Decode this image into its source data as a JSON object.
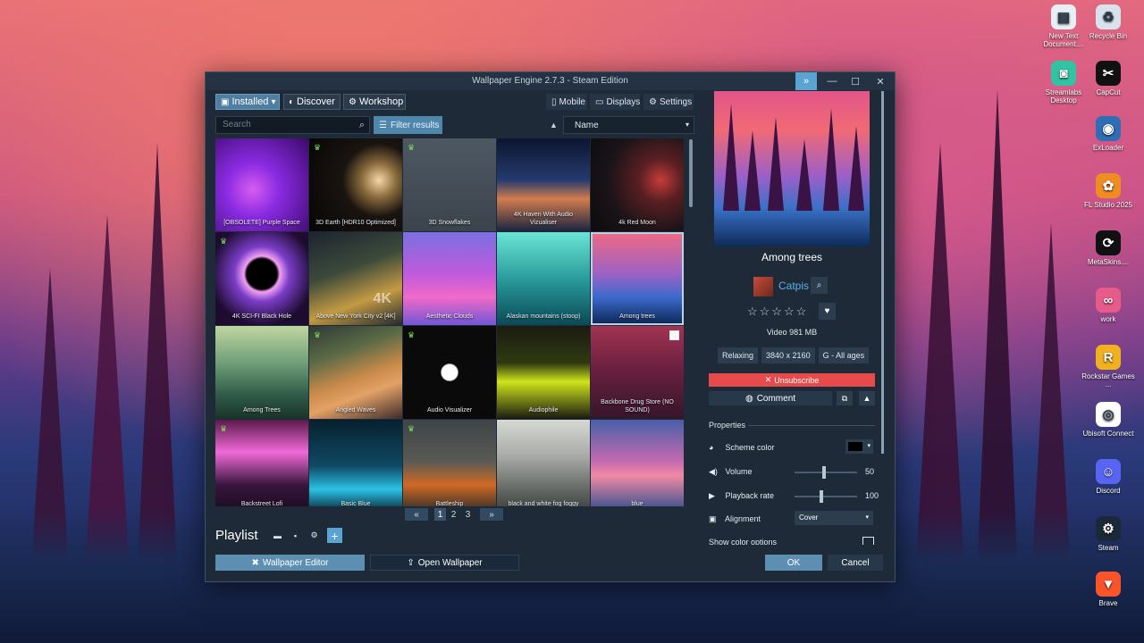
{
  "window": {
    "title": "Wallpaper Engine 2.7.3 - Steam Edition",
    "nav": {
      "installed": "Installed",
      "discover": "Discover",
      "workshop": "Workshop"
    },
    "right_nav": {
      "mobile": "Mobile",
      "displays": "Displays",
      "settings": "Settings"
    },
    "search_placeholder": "Search",
    "filter_label": "Filter results",
    "sort_value": "Name"
  },
  "wallpapers": [
    {
      "label": "[OBSOLETE] Purple Space",
      "trophy": false
    },
    {
      "label": "3D Earth [HDR10 Optimized]",
      "trophy": true
    },
    {
      "label": "3D Snowflakes",
      "trophy": true
    },
    {
      "label": "4K Haven With Audio Vizualiser",
      "trophy": false
    },
    {
      "label": "4k Red Moon",
      "trophy": false
    },
    {
      "label": "4K SCI-FI Black Hole",
      "trophy": true
    },
    {
      "label": "Above New York City v2 [4K]",
      "trophy": false,
      "overlay": "4K"
    },
    {
      "label": "Aesthetic Clouds",
      "trophy": false
    },
    {
      "label": "Alaskan mountains (stoop)",
      "trophy": false
    },
    {
      "label": "Among trees",
      "trophy": false
    },
    {
      "label": "Among Trees",
      "trophy": false
    },
    {
      "label": "Angled Waves",
      "trophy": true
    },
    {
      "label": "Audio Visualizer",
      "trophy": true
    },
    {
      "label": "Audiophile",
      "trophy": false
    },
    {
      "label": "Backbone Drug Store (NO SOUND)",
      "trophy": false
    },
    {
      "label": "Backstreet Lofi",
      "trophy": true
    },
    {
      "label": "Basic Blue",
      "trophy": false
    },
    {
      "label": "Battleship",
      "trophy": true
    },
    {
      "label": "black and white fog foggy",
      "trophy": false
    },
    {
      "label": "blue",
      "trophy": false
    }
  ],
  "pagination": {
    "pages": [
      "1",
      "2",
      "3"
    ],
    "current": "1"
  },
  "playlist": {
    "title": "Playlist"
  },
  "footer": {
    "editor": "Wallpaper Editor",
    "open": "Open Wallpaper",
    "ok": "OK",
    "cancel": "Cancel"
  },
  "details": {
    "title": "Among trees",
    "author": "Catpis",
    "rating_stars": "☆☆☆☆☆",
    "meta": "Video 981 MB",
    "tags": [
      "Relaxing",
      "3840 x 2160",
      "G - All ages"
    ],
    "unsubscribe": "Unsubscribe",
    "comment": "Comment"
  },
  "properties": {
    "title": "Properties",
    "scheme_color": {
      "label": "Scheme color",
      "value": "#000000"
    },
    "volume": {
      "label": "Volume",
      "value": "50"
    },
    "playback_rate": {
      "label": "Playback rate",
      "value": "100"
    },
    "alignment": {
      "label": "Alignment",
      "value": "Cover"
    },
    "show_color_options": {
      "label": "Show color options"
    }
  },
  "desktop_icons": [
    {
      "label": "New Text Document....",
      "name": "text-document-icon",
      "glyph": "▤",
      "color": "#e8eef4"
    },
    {
      "label": "Recycle Bin",
      "name": "recycle-bin-icon",
      "glyph": "♻",
      "color": "#d8e2ec"
    },
    {
      "label": "Streamlabs Desktop",
      "name": "streamlabs-icon",
      "glyph": "◙",
      "color": "#31c3a2"
    },
    {
      "label": "CapCut",
      "name": "capcut-icon",
      "glyph": "✂",
      "color": "#111111"
    },
    {
      "label": "ExLoader",
      "name": "exloader-icon",
      "glyph": "◉",
      "color": "#2f6db5"
    },
    {
      "label": "FL Studio 2025",
      "name": "fl-studio-icon",
      "glyph": "✿",
      "color": "#f08c24"
    },
    {
      "label": "MetaSkins....",
      "name": "metaskins-icon",
      "glyph": "⟳",
      "color": "#111111"
    },
    {
      "label": "work",
      "name": "work-icon",
      "glyph": "∞",
      "color": "#e65b8a"
    },
    {
      "label": "Rockstar Games ...",
      "name": "rockstar-icon",
      "glyph": "R",
      "color": "#f0b020"
    },
    {
      "label": "Ubisoft Connect",
      "name": "ubisoft-icon",
      "glyph": "◎",
      "color": "#ffffff"
    },
    {
      "label": "Discord",
      "name": "discord-icon",
      "glyph": "☺",
      "color": "#5865f2"
    },
    {
      "label": "Steam",
      "name": "steam-icon",
      "glyph": "⚙",
      "color": "#1b2838"
    },
    {
      "label": "Brave",
      "name": "brave-icon",
      "glyph": "▼",
      "color": "#fb542b"
    }
  ]
}
